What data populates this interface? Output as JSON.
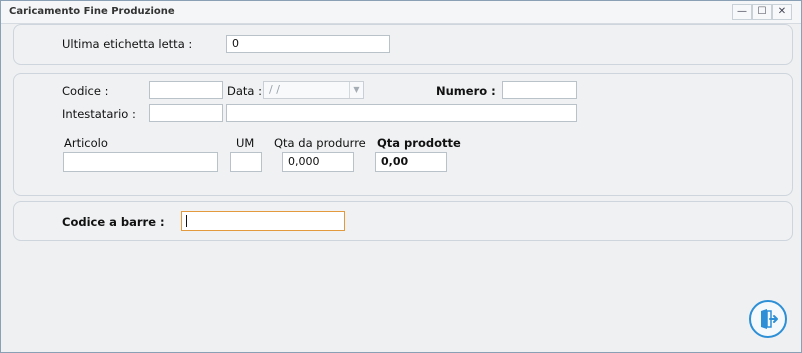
{
  "window": {
    "title": "Caricamento Fine Produzione",
    "controls": {
      "minimize": "—",
      "maximize": "☐",
      "close": "✕"
    }
  },
  "scan_panel": {
    "last_label_label": "Ultima etichetta letta :",
    "last_label_value": "0"
  },
  "order_panel": {
    "codice_label": "Codice :",
    "codice_value": "",
    "data_label": "Data :",
    "data_value": " /  /",
    "numero_label": "Numero :",
    "numero_value": "",
    "intestatario_label": "Intestatario :",
    "intestatario_code": "",
    "intestatario_name": "",
    "articolo_label": "Articolo",
    "articolo_value": "",
    "um_label": "UM",
    "um_value": "",
    "qta_da_produrre_label": "Qta da produrre",
    "qta_da_produrre_value": "0,000",
    "qta_prodotte_label": "Qta prodotte",
    "qta_prodotte_value": "0,00"
  },
  "barcode_panel": {
    "label": "Codice a barre :",
    "value": ""
  },
  "icons": {
    "exit": "exit-door-icon",
    "accent": "#2d8fd6"
  }
}
